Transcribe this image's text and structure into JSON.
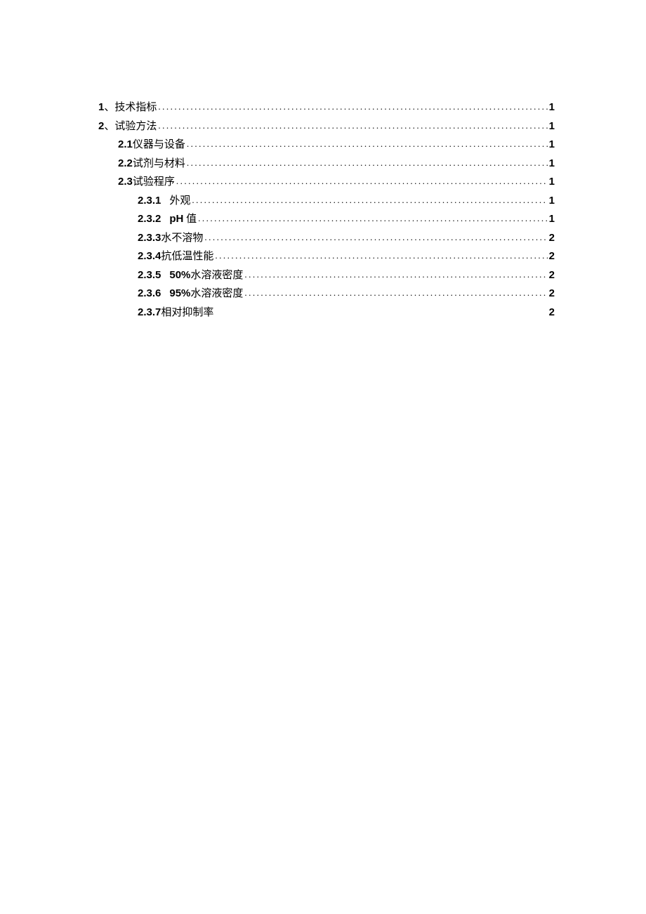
{
  "toc": {
    "entries": [
      {
        "level": 1,
        "num": "1",
        "sep": "、",
        "title": "技术指标",
        "leader": true,
        "page": "1",
        "num_bold": true,
        "spaced": false
      },
      {
        "level": 1,
        "num": "2",
        "sep": "、",
        "title": "试验方法",
        "leader": true,
        "page": "1",
        "num_bold": true,
        "spaced": false
      },
      {
        "level": 2,
        "num": "2.1",
        "sep": " ",
        "title": "仪器与设备",
        "leader": true,
        "page": "1",
        "num_bold": true,
        "spaced": false
      },
      {
        "level": 2,
        "num": "2.2",
        "sep": " ",
        "title": "试剂与材料",
        "leader": true,
        "page": "1",
        "num_bold": true,
        "spaced": false
      },
      {
        "level": 2,
        "num": "2.3",
        "sep": " ",
        "title": "试验程序",
        "leader": true,
        "page": "1",
        "num_bold": true,
        "spaced": false
      },
      {
        "level": 3,
        "num": "2.3.1",
        "sep": "",
        "title": "外观",
        "leader": true,
        "page": "1",
        "num_bold": true,
        "spaced": true
      },
      {
        "level": 3,
        "num": "2.3.2",
        "sep": "",
        "title_prefix": "pH",
        "title": " 值",
        "leader": true,
        "page": "1",
        "num_bold": true,
        "spaced": true,
        "prefix_bold": true
      },
      {
        "level": 3,
        "num": "2.3.3",
        "sep": " ",
        "title": "水不溶物",
        "leader": true,
        "page": "2",
        "num_bold": true,
        "spaced": false
      },
      {
        "level": 3,
        "num": "2.3.4",
        "sep": " ",
        "title": "抗低温性能",
        "leader": true,
        "page": "2",
        "num_bold": true,
        "spaced": false
      },
      {
        "level": 3,
        "num": "2.3.5",
        "sep": "",
        "title_prefix": "50%",
        "title": "水溶液密度",
        "leader": true,
        "page": "2",
        "num_bold": true,
        "spaced": true,
        "prefix_bold": true
      },
      {
        "level": 3,
        "num": "2.3.6",
        "sep": "",
        "title_prefix": "95%",
        "title": "水溶液密度",
        "leader": true,
        "page": "2",
        "num_bold": true,
        "spaced": true,
        "prefix_bold": true
      },
      {
        "level": 3,
        "num": "2.3.7",
        "sep": " ",
        "title": "相对抑制率",
        "leader": false,
        "page": "2",
        "num_bold": true,
        "spaced": false
      }
    ],
    "leader_dots": "................................................................................................................................................"
  }
}
